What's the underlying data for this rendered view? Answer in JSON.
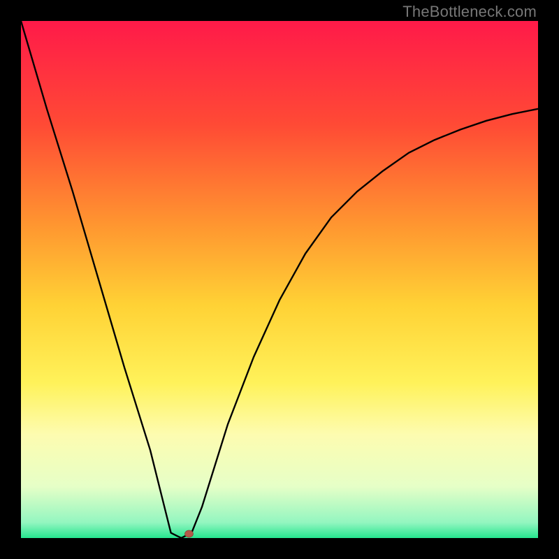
{
  "watermark": "TheBottleneck.com",
  "chart_data": {
    "type": "line",
    "title": "",
    "xlabel": "",
    "ylabel": "",
    "note": "No axis labels or tick values are visible in the image; curve values are estimated as fractions of the plot height and width",
    "xlim": [
      0,
      1
    ],
    "ylim": [
      0,
      1
    ],
    "series": [
      {
        "name": "bottleneck-curve",
        "points_normalized": [
          {
            "x": 0.0,
            "y": 1.0
          },
          {
            "x": 0.05,
            "y": 0.83
          },
          {
            "x": 0.1,
            "y": 0.67
          },
          {
            "x": 0.15,
            "y": 0.5
          },
          {
            "x": 0.2,
            "y": 0.33
          },
          {
            "x": 0.25,
            "y": 0.17
          },
          {
            "x": 0.28,
            "y": 0.05
          },
          {
            "x": 0.29,
            "y": 0.01
          },
          {
            "x": 0.31,
            "y": 0.0
          },
          {
            "x": 0.33,
            "y": 0.01
          },
          {
            "x": 0.35,
            "y": 0.06
          },
          {
            "x": 0.4,
            "y": 0.22
          },
          {
            "x": 0.45,
            "y": 0.35
          },
          {
            "x": 0.5,
            "y": 0.46
          },
          {
            "x": 0.55,
            "y": 0.55
          },
          {
            "x": 0.6,
            "y": 0.62
          },
          {
            "x": 0.65,
            "y": 0.67
          },
          {
            "x": 0.7,
            "y": 0.71
          },
          {
            "x": 0.75,
            "y": 0.745
          },
          {
            "x": 0.8,
            "y": 0.77
          },
          {
            "x": 0.85,
            "y": 0.79
          },
          {
            "x": 0.9,
            "y": 0.807
          },
          {
            "x": 0.95,
            "y": 0.82
          },
          {
            "x": 1.0,
            "y": 0.83
          }
        ]
      }
    ],
    "marker": {
      "name": "min-point",
      "x_norm": 0.325,
      "y_norm": 0.0,
      "color": "#b45a4a"
    },
    "gradient_stops": [
      {
        "offset": 0.0,
        "color": "#ff1a49"
      },
      {
        "offset": 0.2,
        "color": "#ff4a35"
      },
      {
        "offset": 0.4,
        "color": "#ff9830"
      },
      {
        "offset": 0.55,
        "color": "#ffd235"
      },
      {
        "offset": 0.7,
        "color": "#fff25a"
      },
      {
        "offset": 0.8,
        "color": "#fdfcb0"
      },
      {
        "offset": 0.9,
        "color": "#e6ffc7"
      },
      {
        "offset": 0.97,
        "color": "#93f6c0"
      },
      {
        "offset": 1.0,
        "color": "#26e58f"
      }
    ]
  }
}
